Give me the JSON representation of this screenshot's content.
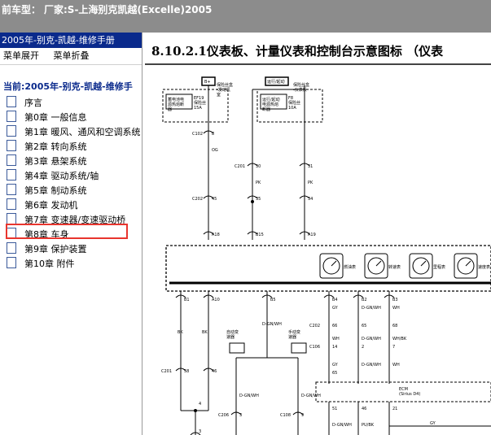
{
  "title_bar": {
    "left_text": "前车型：",
    "main_text": "厂家:S-上海别克凯越(Excelle)2005"
  },
  "sidebar": {
    "header": "2005年-别克-凯越-维修手册",
    "expand_label": "菜单展开",
    "collapse_label": "菜单折叠",
    "current": "当前:2005年-别克-凯越-维修手",
    "items": [
      {
        "label": "序言"
      },
      {
        "label": "第0章 一般信息"
      },
      {
        "label": "第1章 暖风、通风和空调系统"
      },
      {
        "label": "第2章 转向系统"
      },
      {
        "label": "第3章 悬架系统"
      },
      {
        "label": "第4章 驱动系统/轴"
      },
      {
        "label": "第5章 制动系统"
      },
      {
        "label": "第6章 发动机"
      },
      {
        "label": "第7章 变速器/变速驱动桥"
      },
      {
        "label": "第8章 车身",
        "selected": true
      },
      {
        "label": "第9章 保护装置"
      },
      {
        "label": "第10章 附件"
      }
    ]
  },
  "document": {
    "title": "8.10.2.1仪表板、计量仪表和控制台示意图标 （仪表"
  },
  "diagram": {
    "fuse_b": "B+",
    "fuse_run": "运行/起动",
    "fuse_b_note": "保险丝盒\n-发动机\n室",
    "fuse_run_note": "保险丝盒\n-仪表板",
    "ef_box": "EF19\n保险丝\n15A",
    "f_box": "F8\n保险丝\n10A",
    "rel_note_l": "蓄电池电\n源热熔断\n器",
    "rel_note_r": "运行/起动\n电源热熔\n断器",
    "c102": "C102",
    "c102_pin": "8",
    "wire_og": "OG",
    "c201_a": "C201",
    "c201_pins_a": [
      "30",
      "31"
    ],
    "wire_pk": "PK",
    "c202_a": "C202",
    "c202_pin": "45",
    "c202_pins_b": [
      "35",
      "34"
    ],
    "pins_top": [
      "A18",
      "B15",
      "A19"
    ],
    "gauge_labels": [
      "燃油表",
      "转速表",
      "里程表",
      "速度表"
    ],
    "pins_lower": [
      "B1",
      "A10",
      "B5",
      "B4",
      "B2",
      "B3"
    ],
    "wire_bk": "BK",
    "wire_dgnwh": "D-GN/WH",
    "auto_trans": "自动变\n速器",
    "manual_trans": "手动变\n速器",
    "c202_b": "C202",
    "c202_b_pins": [
      "66",
      "65",
      "68",
      "7",
      "65"
    ],
    "c106": "C106",
    "c106_pins": [
      "14",
      "2"
    ],
    "wire_gy": "GY",
    "wire_wh": "WH",
    "wire_whbk": "WH/BK",
    "c201_b": "C201",
    "c201_b_pins": [
      "58",
      "46"
    ],
    "c206": "C206",
    "c206_pin": "3",
    "c108": "C108",
    "c108_pin": "9",
    "ecm": "ECM\n(Sirius D4)",
    "ecm_pins": [
      "51",
      "46",
      "21"
    ],
    "wire_pubk": "PU/BK",
    "pin4": "4",
    "pin3": "3"
  }
}
